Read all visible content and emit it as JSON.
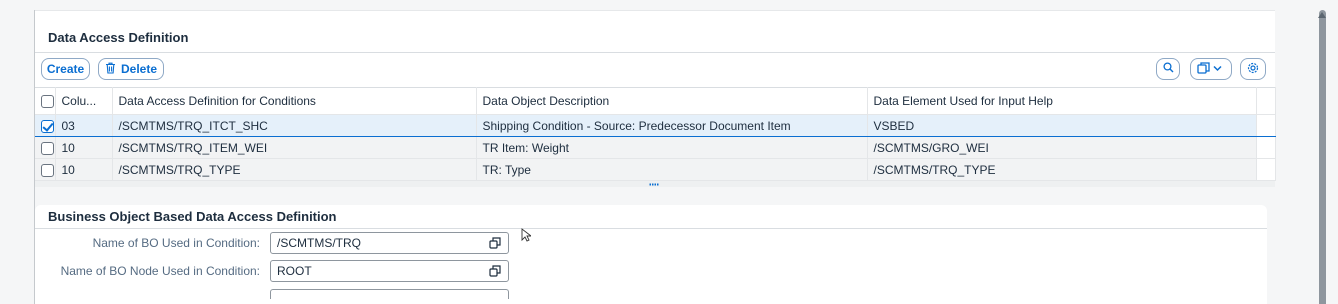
{
  "section1": {
    "title": "Data Access Definition",
    "create_label": "Create",
    "delete_label": "Delete",
    "columns": [
      "Colu...",
      "Data Access Definition for Conditions",
      "Data Object Description",
      "Data Element Used for Input Help"
    ],
    "rows": [
      {
        "checked": true,
        "col": "03",
        "dad": "/SCMTMS/TRQ_ITCT_SHC",
        "desc": "Shipping Condition - Source: Predecessor Document Item",
        "elem": "VSBED"
      },
      {
        "checked": false,
        "col": "10",
        "dad": "/SCMTMS/TRQ_ITEM_WEI",
        "desc": "TR Item: Weight",
        "elem": "/SCMTMS/GRO_WEI"
      },
      {
        "checked": false,
        "col": "10",
        "dad": "/SCMTMS/TRQ_TYPE",
        "desc": "TR: Type",
        "elem": "/SCMTMS/TRQ_TYPE"
      }
    ]
  },
  "section2": {
    "title": "Business Object Based Data Access Definition",
    "bo_label": "Name of BO Used in Condition:",
    "bo_value": "/SCMTMS/TRQ",
    "node_label": "Name of BO Node Used in Condition:",
    "node_value": "ROOT"
  },
  "icons": {
    "delete": "trash-icon",
    "search": "search-icon",
    "export": "export-icon",
    "settings": "gear-icon",
    "value_help": "value-help-icon"
  },
  "colors": {
    "accent": "#0a6ed1",
    "selected_row": "#e5f0fa"
  }
}
